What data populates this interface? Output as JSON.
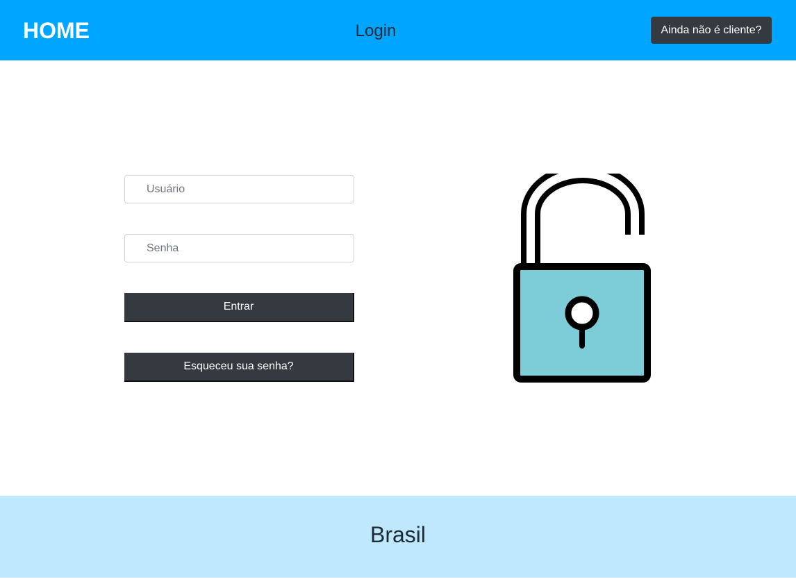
{
  "header": {
    "brand": "HOME",
    "title": "Login",
    "signup_label": "Ainda não é cliente?"
  },
  "form": {
    "username_placeholder": "Usuário",
    "username_value": "",
    "password_placeholder": "Senha",
    "password_value": "",
    "login_label": "Entrar",
    "forgot_label": "Esqueceu sua senha?"
  },
  "footer": {
    "text": "Brasil"
  },
  "icons": {
    "lock": "unlocked-padlock-icon"
  },
  "colors": {
    "header_bg": "#00a5ff",
    "button_dark": "#343a40",
    "lock_body": "#7ccdd8",
    "footer_bg": "#bfe8fd"
  }
}
